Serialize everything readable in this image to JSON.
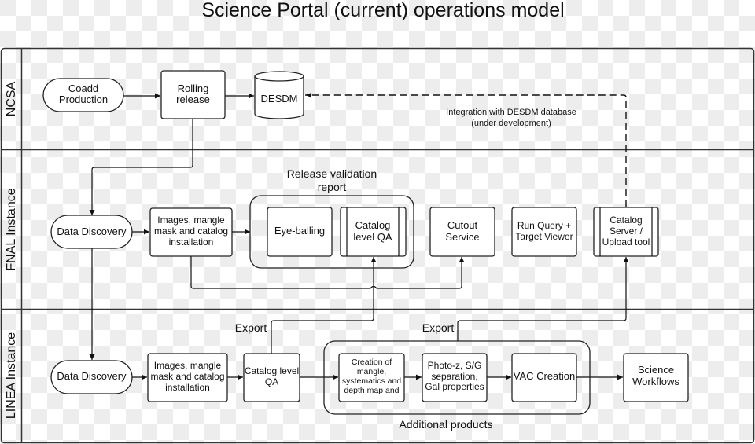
{
  "title": "Science Portal (current) operations model",
  "lanes": [
    {
      "id": "ncsa",
      "label": "NCSA"
    },
    {
      "id": "fnal",
      "label": "FNAL Instance"
    },
    {
      "id": "linea",
      "label": "LINEA Instance"
    }
  ],
  "nodes": {
    "coadd_production": {
      "lines": [
        "Coadd",
        "Production"
      ],
      "shape": "terminator",
      "lane": "NCSA"
    },
    "rolling_release": {
      "lines": [
        "Rolling",
        "release"
      ],
      "shape": "process",
      "lane": "NCSA"
    },
    "desdm": {
      "lines": [
        "DESDM"
      ],
      "shape": "database",
      "lane": "NCSA"
    },
    "fnal_data_discovery": {
      "lines": [
        "Data Discovery"
      ],
      "shape": "terminator",
      "lane": "FNAL Instance"
    },
    "fnal_images_install": {
      "lines": [
        "Images, mangle",
        "mask and catalog",
        "installation"
      ],
      "shape": "process",
      "lane": "FNAL Instance"
    },
    "eye_balling": {
      "lines": [
        "Eye-balling"
      ],
      "shape": "process",
      "lane": "FNAL Instance"
    },
    "fnal_catalog_qa": {
      "lines": [
        "Catalog",
        "level QA"
      ],
      "shape": "predefined-process",
      "lane": "FNAL Instance"
    },
    "cutout_service": {
      "lines": [
        "Cutout",
        "Service"
      ],
      "shape": "process",
      "lane": "FNAL Instance"
    },
    "run_query": {
      "lines": [
        "Run Query +",
        "Target Viewer"
      ],
      "shape": "process",
      "lane": "FNAL Instance"
    },
    "catalog_server": {
      "lines": [
        "Catalog",
        "Server /",
        "Upload tool"
      ],
      "shape": "predefined-process",
      "lane": "FNAL Instance"
    },
    "linea_data_discovery": {
      "lines": [
        "Data Discovery"
      ],
      "shape": "terminator",
      "lane": "LINEA Instance"
    },
    "linea_images_install": {
      "lines": [
        "Images, mangle",
        "mask and catalog",
        "installation"
      ],
      "shape": "process",
      "lane": "LINEA Instance"
    },
    "linea_catalog_qa": {
      "lines": [
        "Catalog level",
        "QA"
      ],
      "shape": "process",
      "lane": "LINEA Instance"
    },
    "mangle_creation": {
      "lines": [
        "Creation of",
        "mangle,",
        "systematics and",
        "depth map and"
      ],
      "shape": "process",
      "lane": "LINEA Instance"
    },
    "photoz": {
      "lines": [
        "Photo-z, S/G",
        "separation,",
        "Gal properties"
      ],
      "shape": "process",
      "lane": "LINEA Instance"
    },
    "vac_creation": {
      "lines": [
        "VAC Creation"
      ],
      "shape": "process",
      "lane": "LINEA Instance"
    },
    "science_workflows": {
      "lines": [
        "Science",
        "Workflows"
      ],
      "shape": "process",
      "lane": "LINEA Instance"
    }
  },
  "groups": {
    "release_validation": {
      "lines": [
        "Release validation",
        "report"
      ]
    },
    "additional_products": {
      "label": "Additional products"
    }
  },
  "annotations": {
    "integration": [
      "Integration with  DESDM  database",
      "(under development)"
    ],
    "export_1": "Export",
    "export_2": "Export"
  },
  "edges": [
    {
      "from": "Coadd Production",
      "to": "Rolling release"
    },
    {
      "from": "Rolling release",
      "to": "DESDM"
    },
    {
      "from": "Rolling release",
      "to": "Data Discovery (FNAL)"
    },
    {
      "from": "Data Discovery (FNAL)",
      "to": "Images, mangle mask and catalog installation (FNAL)"
    },
    {
      "from": "Images, mangle mask and catalog installation (FNAL)",
      "to": "Release validation report"
    },
    {
      "from": "Images, mangle mask and catalog installation (FNAL)",
      "to": "Cutout Service"
    },
    {
      "from": "Data Discovery (FNAL)",
      "to": "Data Discovery (LINEA)"
    },
    {
      "from": "Data Discovery (LINEA)",
      "to": "Images, mangle mask and catalog installation (LINEA)"
    },
    {
      "from": "Images, mangle mask and catalog installation (LINEA)",
      "to": "Catalog level QA (LINEA)"
    },
    {
      "from": "Catalog level QA (LINEA)",
      "to": "Creation of mangle, systematics and depth map"
    },
    {
      "from": "Creation of mangle, systematics and depth map",
      "to": "Photo-z, S/G separation, Gal properties"
    },
    {
      "from": "Photo-z, S/G separation, Gal properties",
      "to": "VAC Creation"
    },
    {
      "from": "VAC Creation",
      "to": "Science Workflows"
    },
    {
      "from": "Catalog level QA (LINEA)",
      "to": "Catalog level QA (FNAL)",
      "label": "Export"
    },
    {
      "from": "Additional products",
      "to": "Catalog Server / Upload tool",
      "label": "Export"
    },
    {
      "from": "Catalog Server / Upload tool",
      "to": "DESDM",
      "style": "dashed",
      "label": "Integration with DESDM database (under development)"
    }
  ]
}
